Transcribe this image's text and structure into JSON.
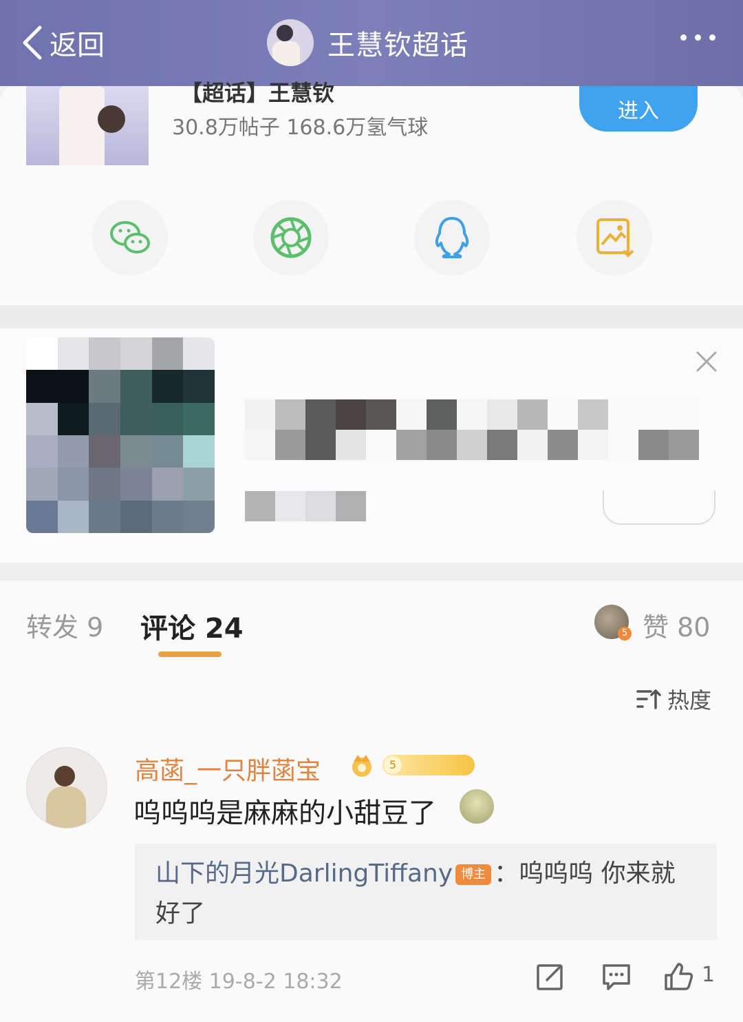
{
  "nav": {
    "back_label": "返回",
    "title": "王慧钦超话",
    "more_icon": "more-dots-icon"
  },
  "topic": {
    "title": "【超话】王慧钦",
    "stats": "30.8万帖子 168.6万氢气球",
    "enter_label": "进入"
  },
  "share": [
    {
      "icon": "wechat-icon",
      "color": "#5bbf6b"
    },
    {
      "icon": "moments-icon",
      "color": "#5bbf6b"
    },
    {
      "icon": "qq-icon",
      "color": "#3ea0e6"
    },
    {
      "icon": "save-image-icon",
      "color": "#e8b13a"
    }
  ],
  "tabs": {
    "repost": "转发 9",
    "comment": "评论 24",
    "like": "赞 80",
    "like_badge": "5",
    "underline_color": "#e8a23a"
  },
  "sort_label": "热度",
  "comment": {
    "name": "高菡_一只胖菡宝",
    "level": "5",
    "text": "呜呜呜是麻麻的小甜豆了",
    "reply": {
      "name": "山下的月光DarlingTiffany",
      "badge": "博主",
      "text": "：呜呜呜 你来就好了"
    },
    "meta": "第12楼 19-8-2 18:32",
    "like_count": "1"
  }
}
